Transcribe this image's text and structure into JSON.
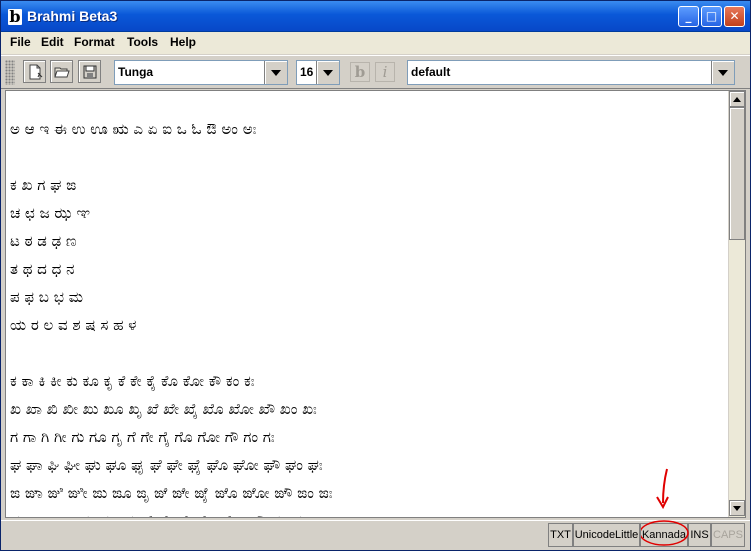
{
  "window": {
    "title": "Brahmi Beta3",
    "app_icon_glyph": "b",
    "controls": {
      "minimize": "_",
      "maximize": "□",
      "close": "✕"
    }
  },
  "menubar": {
    "items": [
      {
        "label": "File"
      },
      {
        "label": "Edit"
      },
      {
        "label": "Format"
      },
      {
        "label": "Tools"
      },
      {
        "label": "Help"
      }
    ]
  },
  "toolbar": {
    "buttons": [
      {
        "icon": "new-document-icon"
      },
      {
        "icon": "open-folder-icon"
      },
      {
        "icon": "save-disk-icon"
      }
    ],
    "font_combo": {
      "value": "Tunga"
    },
    "size_combo": {
      "value": "16"
    },
    "bold_label": "b",
    "italic_label": "i",
    "style_combo": {
      "value": "default"
    }
  },
  "editor": {
    "lines": [
      "ಅ ಆ ಇ ಈ ಉ ಊ ಋ ಎ ಏ ಐ ಒ ಓ ಔ ಅಂ ಅಃ",
      "",
      "ಕ ಖ ಗ ಘ ಙ",
      "ಚ ಛ ಜ ಝ ಞ",
      "ಟ ಠ ಡ ಢ ಣ",
      "ತ ಥ ದ ಧ ನ",
      "ಪ ಫ ಬ ಭ ಮ",
      "ಯ ರ ಲ ವ  ಶ ಷ ಸ ಹ ಳ",
      "",
      "ಕ ಕಾ ಕಿ ಕೀ ಕು ಕೂ ಕೃ ಕೆ ಕೇ ಕೈ ಕೊ ಕೋ ಕೌ ಕಂ ಕಃ",
      "ಖ ಖಾ ಖಿ ಖೀ ಖು ಖೂ ಖೃ ಖೆ ಖೇ ಖೈ ಖೊ ಖೋ ಖೌ ಖಂ ಖಃ",
      "ಗ ಗಾ ಗಿ ಗೀ ಗು ಗೂ ಗೃ ಗೆ ಗೇ ಗೈ ಗೊ ಗೋ ಗೌ ಗಂ ಗಃ",
      "ಘ ಘಾ ಘಿ ಘೀ ಘು ಘೂ ಘೃ ಘೆ ಘೇ ಘೈ ಘೊ ಘೋ ಘೌ ಘಂ ಘಃ",
      "ಙ ಙಾ ಙಿ ಙೀ ಙು ಙೂ ಙೃ ಙೆ ಙೇ ಙೈ ಙೊ ಙೋ ಙೌ ಙಂ ಙಃ",
      "ಚ ಚಾ ಚಿ ಚೀ ಚು ಚೂ ಚೃ ಚೆ ಚೇ ಚೈ ಚೊ ಚೋ ಚೌ ಚಂ ಚಃ"
    ]
  },
  "statusbar": {
    "cells": [
      {
        "label": "TXT"
      },
      {
        "label": "UnicodeLittle"
      },
      {
        "label": "Kannada"
      },
      {
        "label": "INS"
      },
      {
        "label": "CAPS"
      }
    ]
  },
  "colors": {
    "title_bar": "#0a58d8",
    "annotation": "#e00000"
  }
}
